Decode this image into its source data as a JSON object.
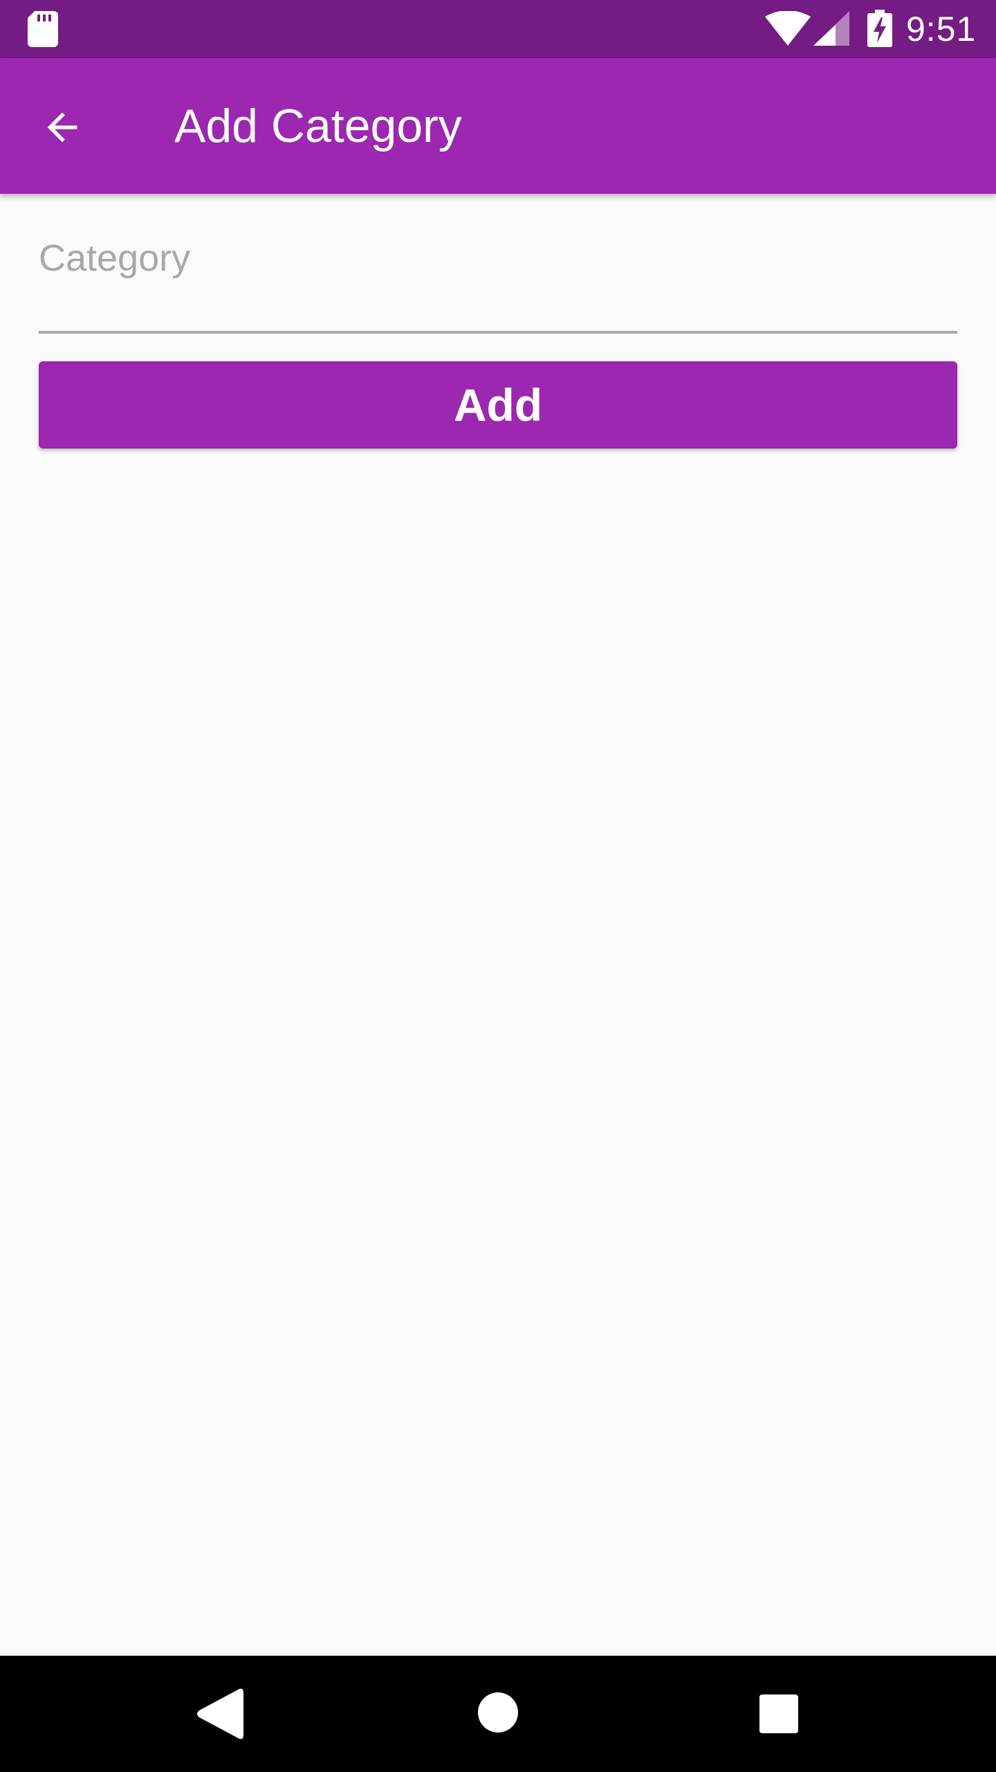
{
  "status_bar": {
    "time": "9:51",
    "icons": [
      "sd-card-icon",
      "wifi-icon",
      "cell-signal-icon",
      "battery-charging-icon"
    ],
    "color": "#751c84"
  },
  "app_bar": {
    "title": "Add Category",
    "back_icon": "arrow-back-icon",
    "color": "#9c27b0"
  },
  "form": {
    "category_input": {
      "placeholder": "Category",
      "value": ""
    },
    "add_button_label": "Add",
    "accent": "#9c27b0"
  },
  "nav_bar": {
    "icons": [
      "back-triangle-icon",
      "home-circle-icon",
      "recents-square-icon"
    ]
  }
}
